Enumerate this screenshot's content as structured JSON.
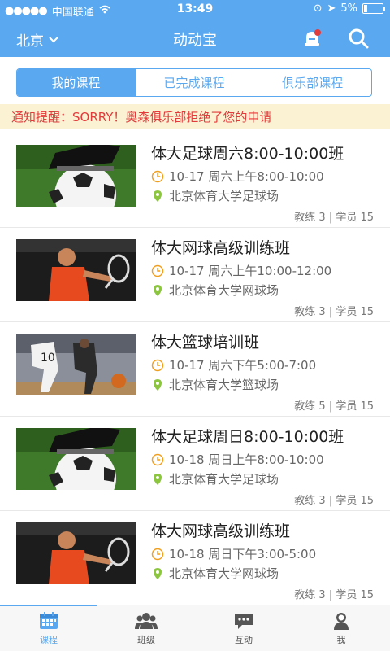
{
  "status": {
    "carrier": "中国联通",
    "time": "13:49",
    "battery": "5%"
  },
  "nav": {
    "city": "北京",
    "title": "动动宝"
  },
  "tabs": [
    "我的课程",
    "已完成课程",
    "俱乐部课程"
  ],
  "notice": "通知提醒：SORRY！奥森俱乐部拒绝了您的申请",
  "courses": [
    {
      "title": "体大足球周六8:00-10:00班",
      "time": "10-17 周六上午8:00-10:00",
      "place": "北京体育大学足球场",
      "coach": "教练 3",
      "students": "| 学员 15",
      "image": "soccer"
    },
    {
      "title": "体大网球高级训练班",
      "time": "10-17 周六上午10:00-12:00",
      "place": "北京体育大学网球场",
      "coach": "教练 3",
      "students": "| 学员 15",
      "image": "tennis"
    },
    {
      "title": "体大篮球培训班",
      "time": "10-17 周六下午5:00-7:00",
      "place": "北京体育大学篮球场",
      "coach": "教练 5",
      "students": "| 学员 15",
      "image": "basketball"
    },
    {
      "title": "体大足球周日8:00-10:00班",
      "time": "10-18 周日上午8:00-10:00",
      "place": "北京体育大学足球场",
      "coach": "教练 3",
      "students": "| 学员 15",
      "image": "soccer"
    },
    {
      "title": "体大网球高级训练班",
      "time": "10-18 周日下午3:00-5:00",
      "place": "北京体育大学网球场",
      "coach": "教练 3",
      "students": "| 学员 15",
      "image": "tennis"
    }
  ],
  "tabbar": [
    "课程",
    "班级",
    "互动",
    "我"
  ],
  "colors": {
    "primary": "#5aa9f0",
    "notice_text": "#e23b3b",
    "notice_bg": "#fbf1d3",
    "clock": "#f0a020",
    "pin": "#8cc63f"
  }
}
